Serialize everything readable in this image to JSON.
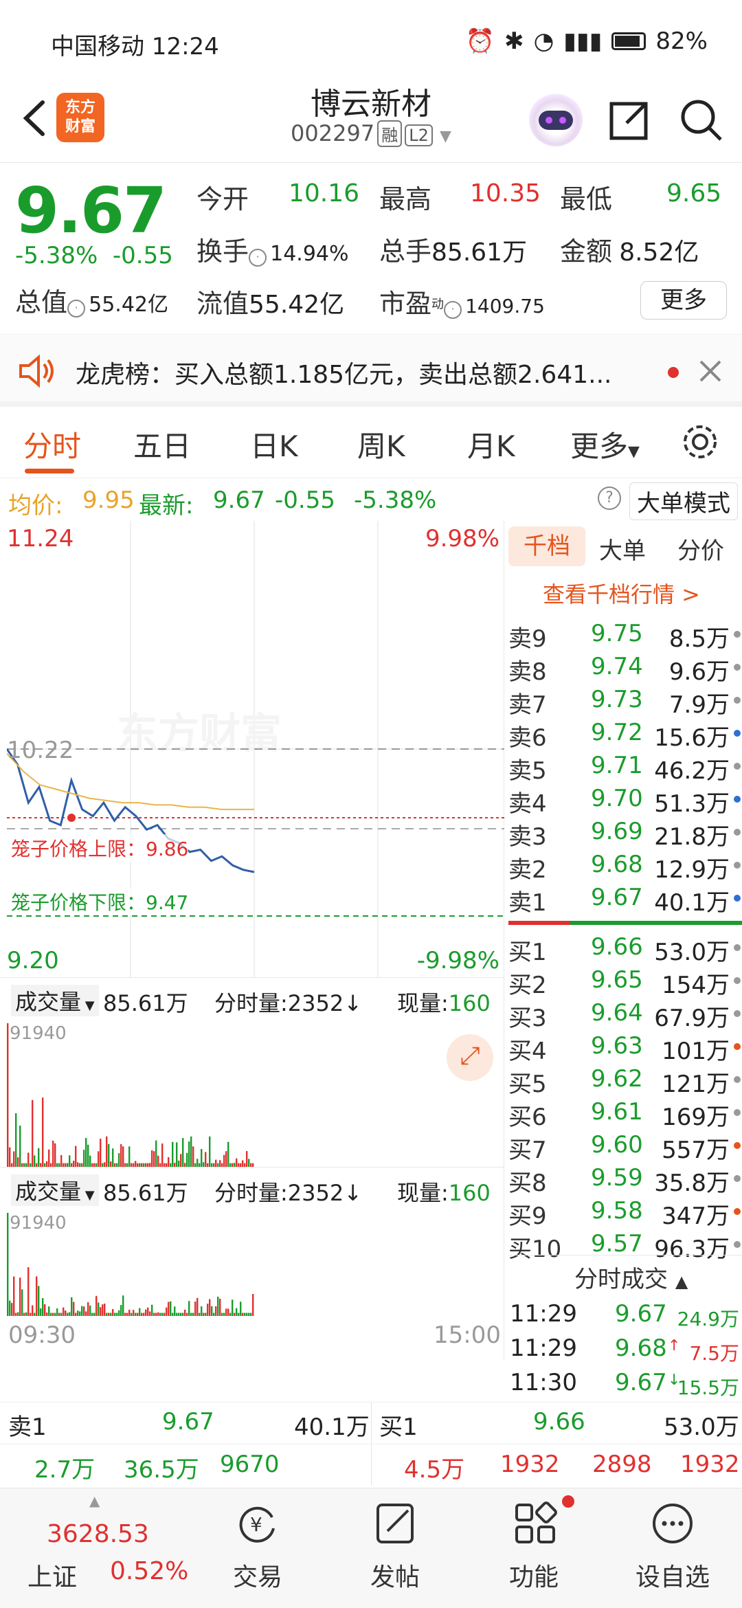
{
  "status_bar": {
    "carrier_time": "中国移动 12:24",
    "battery": "82%"
  },
  "header": {
    "logo_line1": "东方",
    "logo_line2": "财富",
    "title": "博云新材",
    "code": "002297",
    "tag_rong": "融",
    "tag_l2": "L2"
  },
  "quote": {
    "price": "9.67",
    "change_pct": "-5.38%",
    "change": "-0.55",
    "open_label": "今开",
    "open": "10.16",
    "high_label": "最高",
    "high": "10.35",
    "low_label": "最低",
    "low": "9.65",
    "turnover_label": "换手",
    "turnover": "14.94%",
    "volume_label": "总手",
    "volume": "85.61万",
    "amount_label": "金额",
    "amount": "8.52亿",
    "mktcap_label": "总值",
    "mktcap": "55.42亿",
    "float_label": "流值",
    "float_cap": "55.42亿",
    "pe_label": "市盈",
    "pe_sup": "动",
    "pe": "1409.75",
    "more_label": "更多"
  },
  "notice": {
    "text": "龙虎榜：买入总额1.185亿元，卖出总额2.641..."
  },
  "tabs": [
    "分时",
    "五日",
    "日K",
    "周K",
    "月K",
    "更多"
  ],
  "avg_bar": {
    "avg_label": "均价:",
    "avg": "9.95",
    "latest_label": "最新:",
    "latest": "9.67",
    "chg": "-0.55",
    "pct": "-5.38%",
    "big_order": "大单模式"
  },
  "chart": {
    "y_top": "11.24",
    "pct_top": "9.98%",
    "ref": "10.22",
    "y_bottom": "9.20",
    "pct_bottom": "-9.98%",
    "upper_limit": "笼子价格上限：9.86",
    "lower_limit": "笼子价格下限：9.47",
    "watermark": "东方财富",
    "t_start": "09:30",
    "t_end": "15:00"
  },
  "chart_data": {
    "type": "line",
    "title": "",
    "ylim": [
      9.2,
      11.24
    ],
    "series": [
      {
        "values": [
          10.22,
          10.15,
          9.98,
          10.05,
          9.9,
          9.88,
          10.08,
          9.95,
          9.92,
          9.98,
          9.9,
          9.96,
          9.92,
          9.86,
          9.88,
          9.82,
          9.8,
          9.76,
          9.77,
          9.72,
          9.74,
          9.7,
          9.68,
          9.67
        ]
      },
      {
        "values": [
          10.2,
          10.12,
          10.06,
          10.04,
          10.02,
          10.0,
          9.99,
          9.98,
          9.98,
          9.97,
          9.97,
          9.96,
          9.96,
          9.95,
          9.95,
          9.95
        ]
      }
    ]
  },
  "vol_panel1": {
    "label": "成交量",
    "total": "85.61万",
    "minute_label": "分时量:",
    "minute": "2352",
    "now_label": "现量:",
    "now": "160",
    "max": "91940"
  },
  "vol_panel2": {
    "label": "成交量",
    "total": "85.61万",
    "minute_label": "分时量:",
    "minute": "2352",
    "now_label": "现量:",
    "now": "160",
    "max": "91940"
  },
  "orderbook": {
    "tabs": [
      "千档",
      "大单",
      "分价"
    ],
    "link": "查看千档行情 >",
    "asks": [
      {
        "l": "卖9",
        "p": "9.75",
        "v": "8.5万",
        "c": "#999"
      },
      {
        "l": "卖8",
        "p": "9.74",
        "v": "9.6万",
        "c": "#999"
      },
      {
        "l": "卖7",
        "p": "9.73",
        "v": "7.9万",
        "c": "#999"
      },
      {
        "l": "卖6",
        "p": "9.72",
        "v": "15.6万",
        "c": "#2f6fd1"
      },
      {
        "l": "卖5",
        "p": "9.71",
        "v": "46.2万",
        "c": "#999"
      },
      {
        "l": "卖4",
        "p": "9.70",
        "v": "51.3万",
        "c": "#2f6fd1"
      },
      {
        "l": "卖3",
        "p": "9.69",
        "v": "21.8万",
        "c": "#999"
      },
      {
        "l": "卖2",
        "p": "9.68",
        "v": "12.9万",
        "c": "#999"
      },
      {
        "l": "卖1",
        "p": "9.67",
        "v": "40.1万",
        "c": "#2f6fd1"
      }
    ],
    "bids": [
      {
        "l": "买1",
        "p": "9.66",
        "v": "53.0万",
        "c": "#999"
      },
      {
        "l": "买2",
        "p": "9.65",
        "v": "154万",
        "c": "#999"
      },
      {
        "l": "买3",
        "p": "9.64",
        "v": "67.9万",
        "c": "#999"
      },
      {
        "l": "买4",
        "p": "9.63",
        "v": "101万",
        "c": "#e5541d"
      },
      {
        "l": "买5",
        "p": "9.62",
        "v": "121万",
        "c": "#999"
      },
      {
        "l": "买6",
        "p": "9.61",
        "v": "169万",
        "c": "#999"
      },
      {
        "l": "买7",
        "p": "9.60",
        "v": "557万",
        "c": "#e5541d"
      },
      {
        "l": "买8",
        "p": "9.59",
        "v": "35.8万",
        "c": "#999"
      },
      {
        "l": "买9",
        "p": "9.58",
        "v": "347万",
        "c": "#e5541d"
      },
      {
        "l": "买10",
        "p": "9.57",
        "v": "96.3万",
        "c": "#999"
      }
    ],
    "trades_title": "分时成交",
    "trades": [
      {
        "t": "11:29",
        "p": "9.67",
        "v": "24.9万",
        "pc": "#1a9c2c",
        "vc": "#1a9c2c",
        "arrow": ""
      },
      {
        "t": "11:29",
        "p": "9.68",
        "v": "7.5万",
        "pc": "#1a9c2c",
        "vc": "#e0312f",
        "arrow": "↑"
      },
      {
        "t": "11:30",
        "p": "9.67",
        "v": "15.5万",
        "pc": "#1a9c2c",
        "vc": "#1a9c2c",
        "arrow": "↓"
      }
    ]
  },
  "bottom_table": {
    "sell_label": "卖1",
    "sell_price": "9.67",
    "sell_vol": "40.1万",
    "buy_label": "买1",
    "buy_price": "9.66",
    "buy_vol": "53.0万",
    "row2_left": [
      "2.7万",
      "36.5万",
      "9670"
    ],
    "row2_right": [
      "4.5万",
      "1932",
      "2898",
      "1932"
    ]
  },
  "nav": {
    "index_value": "3628.53",
    "index_name": "上证",
    "index_pct": "0.52%",
    "trade": "交易",
    "post": "发帖",
    "func": "功能",
    "watch": "设自选"
  }
}
